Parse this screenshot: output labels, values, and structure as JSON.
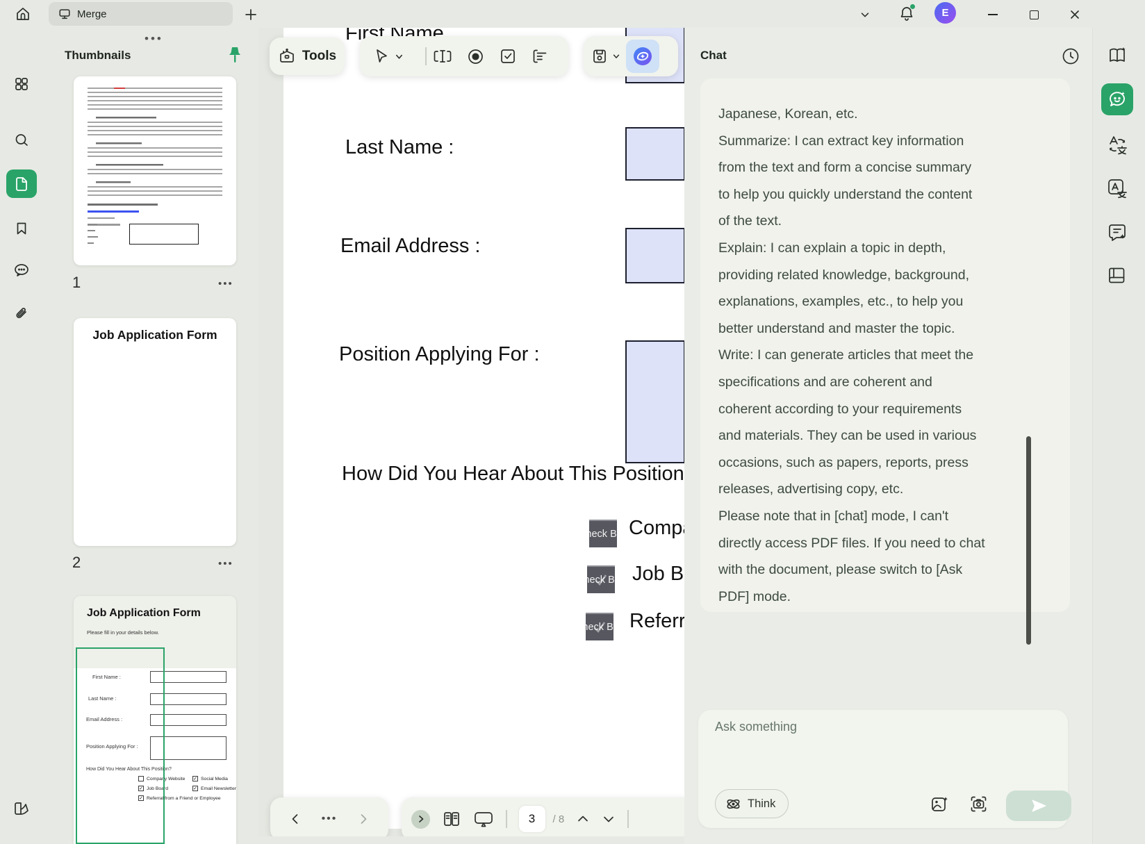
{
  "titlebar": {
    "tab_label": "Merge"
  },
  "account": {
    "avatar_initial": "E"
  },
  "thumbnails": {
    "panel_title": "Thumbnails",
    "page1_number": "1",
    "page2_number": "2",
    "page2_title": "Job Application Form",
    "page3_preview": {
      "title": "Job Application Form",
      "subtitle": "Please fill in your details below.",
      "field_first_name": "First Name :",
      "field_last_name": "Last Name :",
      "field_email": "Email Address :",
      "field_position": "Position Applying For :",
      "question": "How Did You Hear About This Position?",
      "opt_company": "Company Website",
      "opt_social": "Social Media",
      "opt_job": "Job Board",
      "opt_newsletter": "Email Newsletter",
      "opt_referral": "Referral from a Friend or Employee"
    }
  },
  "toolbar": {
    "tools_label": "Tools"
  },
  "document": {
    "label_first_name": "First Name",
    "label_last_name": "Last Name :",
    "label_email": "Email Address :",
    "label_position": "Position Applying For :",
    "question": "How Did You Hear About This Position?",
    "checkbox_field_text": "Check Box",
    "option1": "Company Website",
    "option2": "Job Board",
    "option3": "Referral from a Friend or Employee"
  },
  "pager": {
    "current_page": "3",
    "page_total": "/ 8"
  },
  "chat": {
    "panel_title": "Chat",
    "message_lines": [
      "Japanese, Korean, etc.",
      "Summarize: I can extract key information",
      "from the text and form a concise summary",
      "to help you quickly understand the content",
      "of the text.",
      "Explain: I can explain a topic in depth,",
      "providing related knowledge, background,",
      "explanations, examples, etc., to help you",
      "better understand and master the topic.",
      "Write: I can generate articles that meet the",
      "specifications and are coherent and",
      "coherent according to your requirements",
      "and materials. They can be used in various",
      "occasions, such as papers, reports, press",
      "releases, advertising copy, etc.",
      "Please note that in [chat] mode, I can't",
      "directly access PDF files. If you need to chat",
      "with the document, please switch to [Ask",
      "PDF] mode."
    ],
    "input_placeholder": "Ask something",
    "think_label": "Think"
  },
  "colors": {
    "accent_green": "#2aa368",
    "field_lavender": "#dee2f8",
    "ai_blue": "#4a7bf0"
  }
}
